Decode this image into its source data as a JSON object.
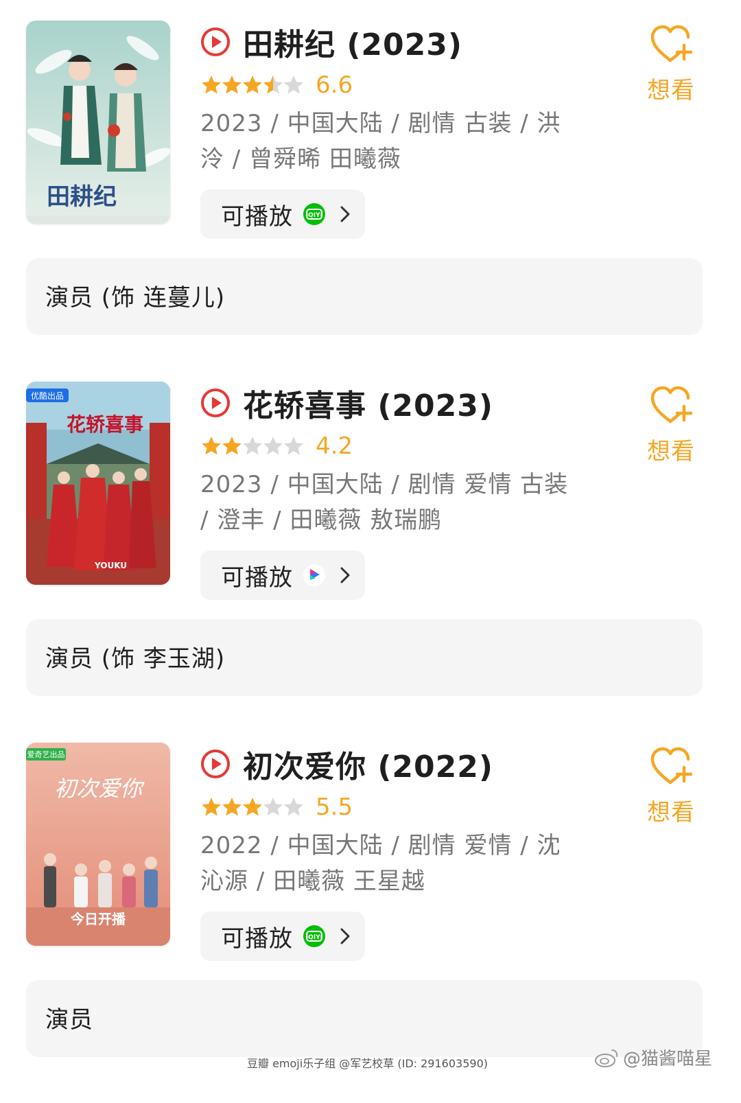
{
  "colors": {
    "accent": "#f5a623",
    "play_red": "#e53935",
    "iqiyi_green": "#00be06",
    "star_empty": "#d8d8d8",
    "pill_bg": "#f4f4f4",
    "cast_bg": "#f5f5f5"
  },
  "entries": [
    {
      "title": "田耕纪 (2023)",
      "rating": 6.6,
      "rating_text": "6.6",
      "stars_filled": 3.5,
      "meta": "2023 / 中国大陆 / 剧情 古装 / 洪泠 / 曾舜晞 田曦薇",
      "play_label": "可播放",
      "platform_icon": "iqiyi-icon",
      "want_label": "想看",
      "cast_label": "演员 (饰 连蔓儿)",
      "poster": {
        "title_text": "田耕纪",
        "theme": "#9cc5bd"
      }
    },
    {
      "title": "花轿喜事 (2023)",
      "rating": 4.2,
      "rating_text": "4.2",
      "stars_filled": 2,
      "meta": "2023 / 中国大陆 / 剧情 爱情 古装 / 澄丰 / 田曦薇 敖瑞鹏",
      "play_label": "可播放",
      "platform_icon": "youku-icon",
      "want_label": "想看",
      "cast_label": "演员 (饰 李玉湖)",
      "poster": {
        "title_text": "花轿喜事",
        "badge_text": "优酷出品",
        "brand_text": "YOUKU",
        "theme": "#c8302c"
      }
    },
    {
      "title": "初次爱你 (2022)",
      "rating": 5.5,
      "rating_text": "5.5",
      "stars_filled": 3,
      "meta": "2022 / 中国大陆 / 剧情 爱情 / 沈沁源 / 田曦薇 王星越",
      "play_label": "可播放",
      "platform_icon": "iqiyi-icon",
      "want_label": "想看",
      "cast_label": "演员",
      "poster": {
        "title_text": "初次爱你",
        "badge_text": "爱奇艺出品",
        "bottom_text": "今日开播",
        "theme": "#e8a393"
      }
    }
  ],
  "footer": {
    "text": "豆瓣 emoji乐子组 @军艺校草 (ID: 291603590)"
  },
  "watermark": {
    "text": "@猫酱喵星"
  }
}
